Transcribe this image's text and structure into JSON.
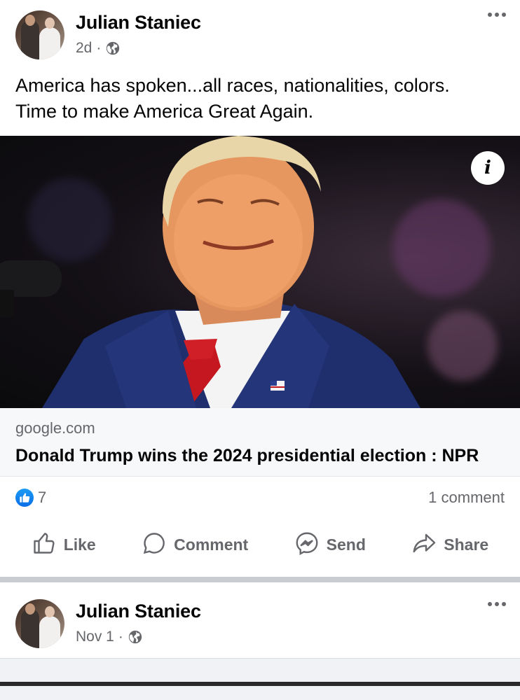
{
  "post1": {
    "author": "Julian Staniec",
    "time": "2d",
    "separator": "·",
    "privacy_icon": "globe-icon",
    "more_icon": "more-options-icon",
    "text_line1": "America has spoken...all races, nationalities, colors.",
    "text_line2": "Time to make America Great Again.",
    "link": {
      "info_label": "i",
      "domain": "google.com",
      "title": "Donald Trump wins the 2024 presidential election : NPR"
    },
    "reactions": {
      "like_count": "7",
      "comments": "1 comment"
    },
    "actions": {
      "like": "Like",
      "comment": "Comment",
      "send": "Send",
      "share": "Share"
    }
  },
  "post2": {
    "author": "Julian Staniec",
    "time": "Nov 1",
    "separator": "·",
    "privacy_icon": "globe-icon",
    "more_icon": "more-options-icon"
  },
  "colors": {
    "secondary_text": "#65676b",
    "like_blue": "#0a6ee6",
    "divider": "#c9ccd1"
  }
}
